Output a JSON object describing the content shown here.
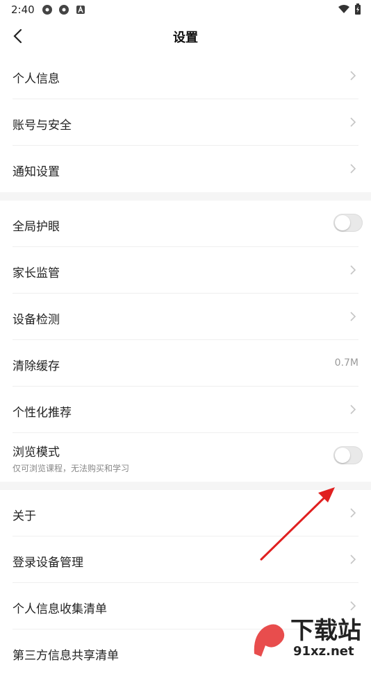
{
  "status_bar": {
    "time": "2:40"
  },
  "nav": {
    "title": "设置"
  },
  "group1": [
    {
      "label": "个人信息"
    },
    {
      "label": "账号与安全"
    },
    {
      "label": "通知设置"
    }
  ],
  "group2": [
    {
      "label": "全局护眼",
      "toggle": false
    },
    {
      "label": "家长监管"
    },
    {
      "label": "设备检测"
    },
    {
      "label": "清除缓存",
      "value": "0.7M"
    },
    {
      "label": "个性化推荐"
    },
    {
      "label": "浏览模式",
      "sub": "仅可浏览课程，无法购买和学习",
      "toggle": false
    }
  ],
  "group3": [
    {
      "label": "关于"
    },
    {
      "label": "登录设备管理"
    },
    {
      "label": "个人信息收集清单"
    },
    {
      "label": "第三方信息共享清单"
    }
  ],
  "watermark": {
    "line1": "下载站",
    "line2": "91xz.net"
  },
  "colors": {
    "arrow": "#e02020",
    "watermark_red": "#e63a3a"
  }
}
